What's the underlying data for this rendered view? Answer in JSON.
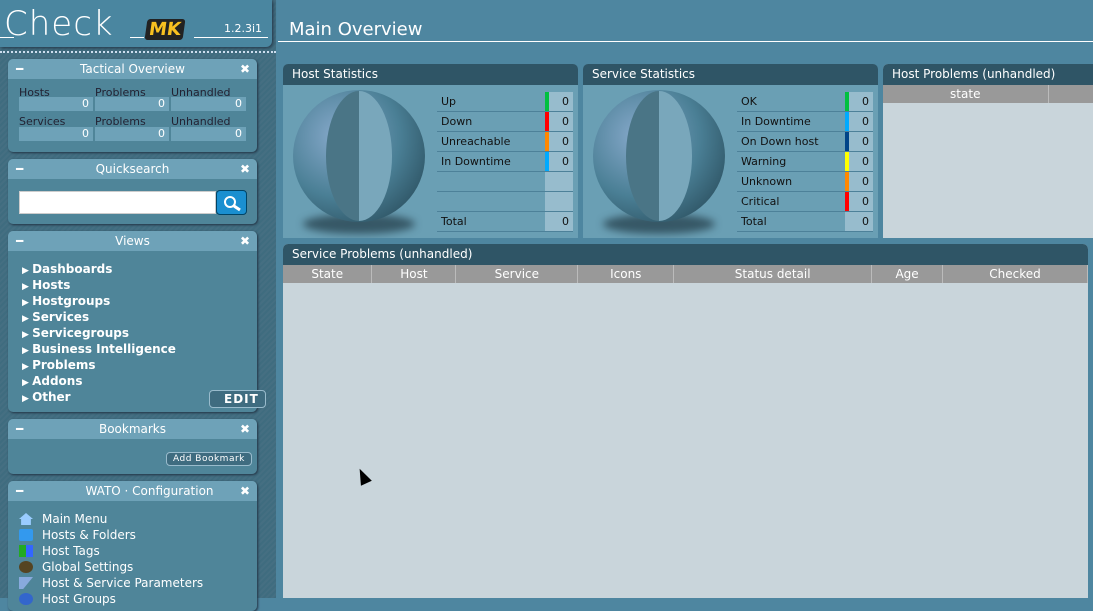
{
  "logo": {
    "text": "Check",
    "mk": "MK",
    "version": "1.2.3i1"
  },
  "page_title": "Main Overview",
  "tactical": {
    "title": "Tactical Overview",
    "rows": [
      {
        "cells": [
          {
            "label": "Hosts",
            "value": "0"
          },
          {
            "label": "Problems",
            "value": "0"
          },
          {
            "label": "Unhandled",
            "value": "0"
          }
        ]
      },
      {
        "cells": [
          {
            "label": "Services",
            "value": "0"
          },
          {
            "label": "Problems",
            "value": "0"
          },
          {
            "label": "Unhandled",
            "value": "0"
          }
        ]
      }
    ]
  },
  "quicksearch": {
    "title": "Quicksearch",
    "value": ""
  },
  "views": {
    "title": "Views",
    "items": [
      "Dashboards",
      "Hosts",
      "Hostgroups",
      "Services",
      "Servicegroups",
      "Business Intelligence",
      "Problems",
      "Addons",
      "Other"
    ],
    "edit": "EDIT"
  },
  "bookmarks": {
    "title": "Bookmarks",
    "add": "Add Bookmark"
  },
  "wato": {
    "title": "WATO · Configuration",
    "items": [
      "Main Menu",
      "Hosts & Folders",
      "Host Tags",
      "Global Settings",
      "Host & Service Parameters",
      "Host Groups"
    ]
  },
  "host_stats": {
    "title": "Host Statistics",
    "rows": [
      {
        "label": "Up",
        "value": "0",
        "color": "#00c040"
      },
      {
        "label": "Down",
        "value": "0",
        "color": "#ff0000"
      },
      {
        "label": "Unreachable",
        "value": "0",
        "color": "#ff8800"
      },
      {
        "label": "In Downtime",
        "value": "0",
        "color": "#00aaff"
      }
    ],
    "total_label": "Total",
    "total": "0"
  },
  "service_stats": {
    "title": "Service Statistics",
    "rows": [
      {
        "label": "OK",
        "value": "0",
        "color": "#00c040"
      },
      {
        "label": "In Downtime",
        "value": "0",
        "color": "#00aaff"
      },
      {
        "label": "On Down host",
        "value": "0",
        "color": "#004488"
      },
      {
        "label": "Warning",
        "value": "0",
        "color": "#ffff00"
      },
      {
        "label": "Unknown",
        "value": "0",
        "color": "#ff8800"
      },
      {
        "label": "Critical",
        "value": "0",
        "color": "#ff0000"
      }
    ],
    "total_label": "Total",
    "total": "0"
  },
  "host_problems": {
    "title": "Host Problems (unhandled)",
    "columns": [
      "state"
    ]
  },
  "service_problems": {
    "title": "Service Problems (unhandled)",
    "columns": [
      "State",
      "Host",
      "Service",
      "Icons",
      "Status detail",
      "Age",
      "Checked"
    ]
  }
}
